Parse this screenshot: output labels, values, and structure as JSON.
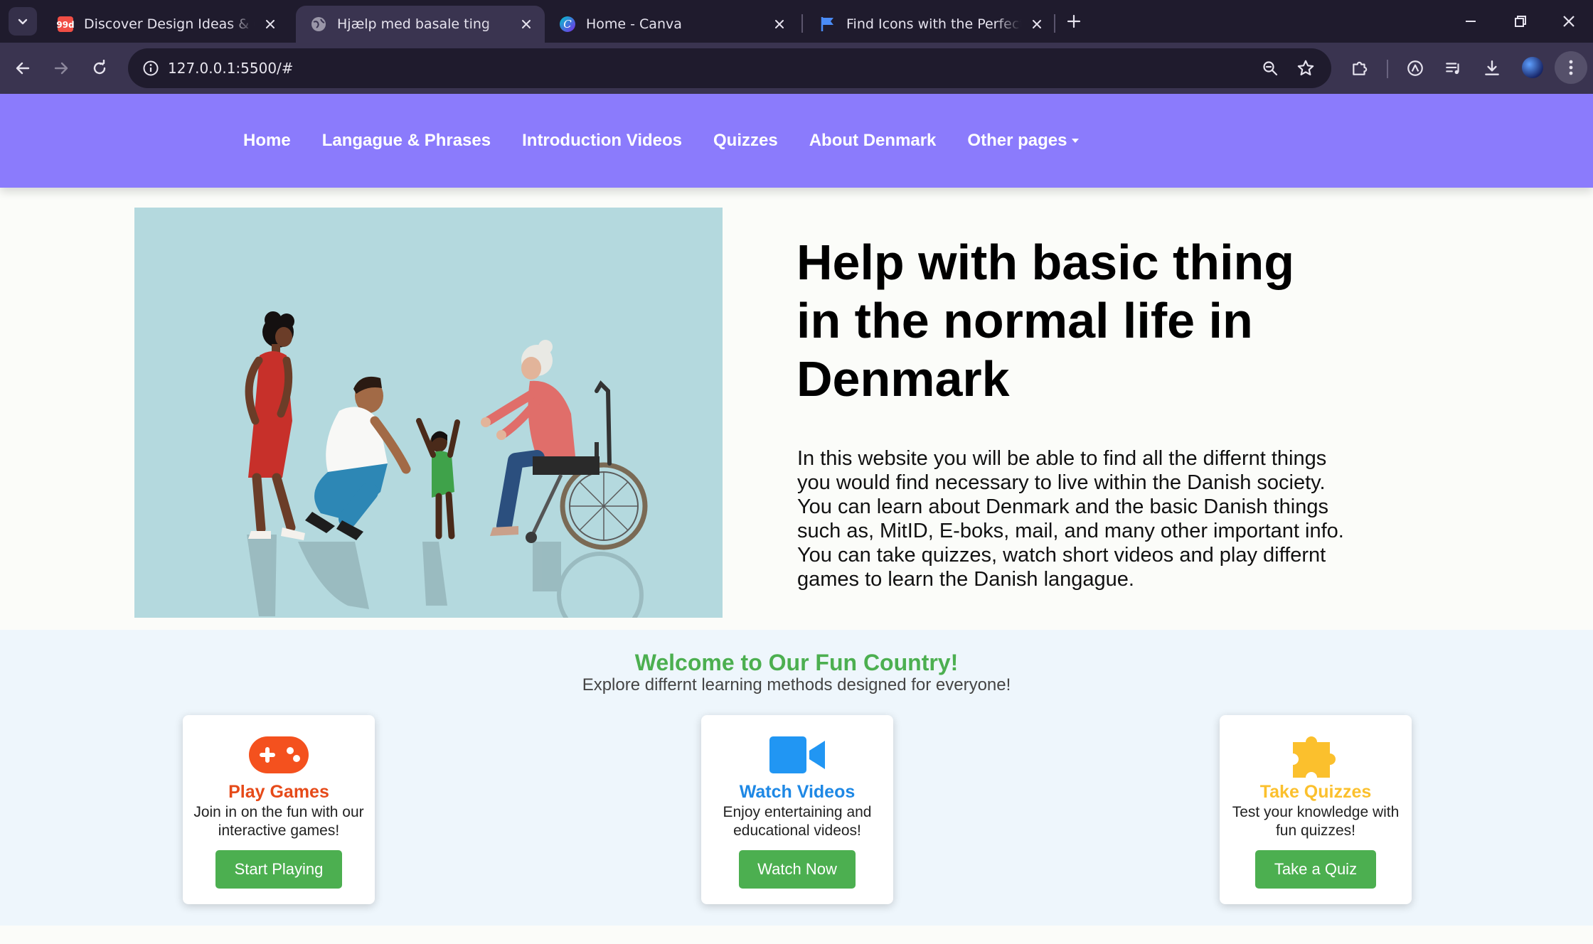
{
  "browser": {
    "tabs": [
      {
        "title": "Discover Design Ideas & Graphi",
        "favicon": "99designs-icon",
        "active": false
      },
      {
        "title": "Hjælp med basale ting",
        "favicon": "globe-icon",
        "active": true
      },
      {
        "title": "Home - Canva",
        "favicon": "canva-icon",
        "active": false
      },
      {
        "title": "Find Icons with the Perfect Look",
        "favicon": "flag-icon",
        "active": false
      }
    ],
    "url": "127.0.0.1:5500/#"
  },
  "nav": {
    "links": [
      "Home",
      "Langague & Phrases",
      "Introduction Videos",
      "Quizzes",
      "About Denmark",
      "Other pages"
    ]
  },
  "hero": {
    "title": "Help with basic thing in the normal life in Denmark",
    "text": "In this website you will be able to find all the differnt things you would find necessary to live within the Danish society. You can learn about Denmark and the basic Danish things such as, MitID, E-boks, mail, and many other important info. You can take quizzes, watch short videos and play differnt games to learn the Danish langague.",
    "image": "family-illustration"
  },
  "features": {
    "title": "Welcome to Our Fun Country!",
    "subtitle": "Explore differnt learning methods designed for everyone!",
    "cards": [
      {
        "icon": "gamepad-icon",
        "title": "Play Games",
        "desc": "Join in on the fun with our interactive games!",
        "button": "Start Playing",
        "color": "#e64a19"
      },
      {
        "icon": "video-camera-icon",
        "title": "Watch Videos",
        "desc": "Enjoy entertaining and educational videos!",
        "button": "Watch Now",
        "color": "#1e88e5"
      },
      {
        "icon": "puzzle-icon",
        "title": "Take Quizzes",
        "desc": "Test your knowledge with fun quizzes!",
        "button": "Take a Quiz",
        "color": "#fbc02d"
      }
    ]
  },
  "colors": {
    "navbar": "#8b7bfc",
    "accent_green": "#4caf50",
    "features_bg": "#eef6fc"
  }
}
